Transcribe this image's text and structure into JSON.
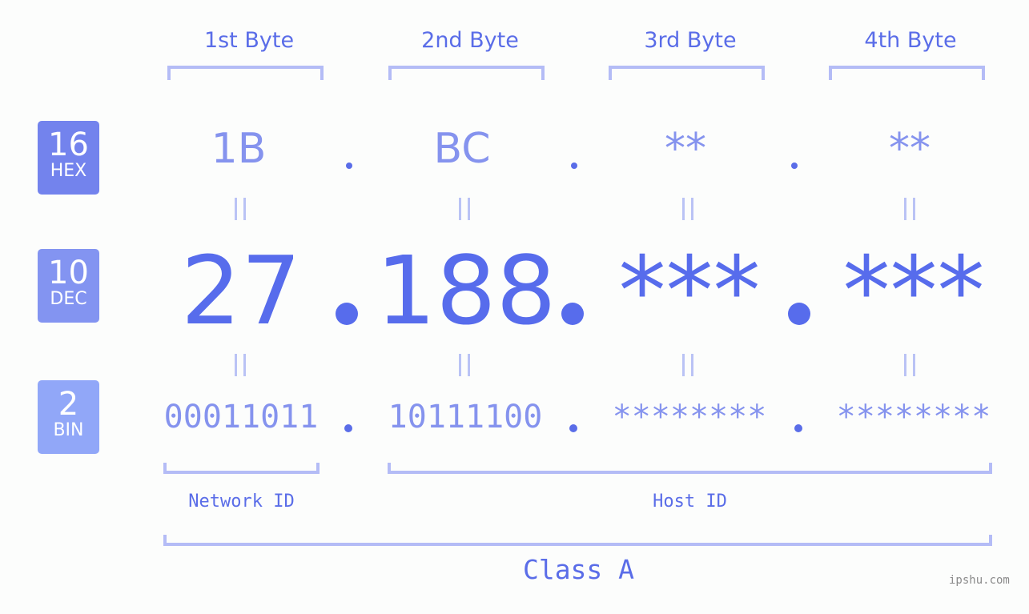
{
  "bytes": [
    {
      "title": "1st Byte",
      "hex": "1B",
      "dec": "27",
      "bin": "00011011"
    },
    {
      "title": "2nd Byte",
      "hex": "BC",
      "dec": "188",
      "bin": "10111100"
    },
    {
      "title": "3rd Byte",
      "hex": "**",
      "dec": "***",
      "bin": "********"
    },
    {
      "title": "4th Byte",
      "hex": "**",
      "dec": "***",
      "bin": "********"
    }
  ],
  "badges": {
    "hex": {
      "number": "16",
      "label": "HEX",
      "color": "#7383ed"
    },
    "dec": {
      "number": "10",
      "label": "DEC",
      "color": "#8394f1"
    },
    "bin": {
      "number": "2",
      "label": "BIN",
      "color": "#91a7f8"
    }
  },
  "labels": {
    "network_id": "Network ID",
    "host_id": "Host ID",
    "class": "Class A"
  },
  "colors": {
    "accent": "#576cec",
    "light_accent": "#8593ee",
    "bracket": "#b4bcf6"
  },
  "watermark": "ipshu.com"
}
